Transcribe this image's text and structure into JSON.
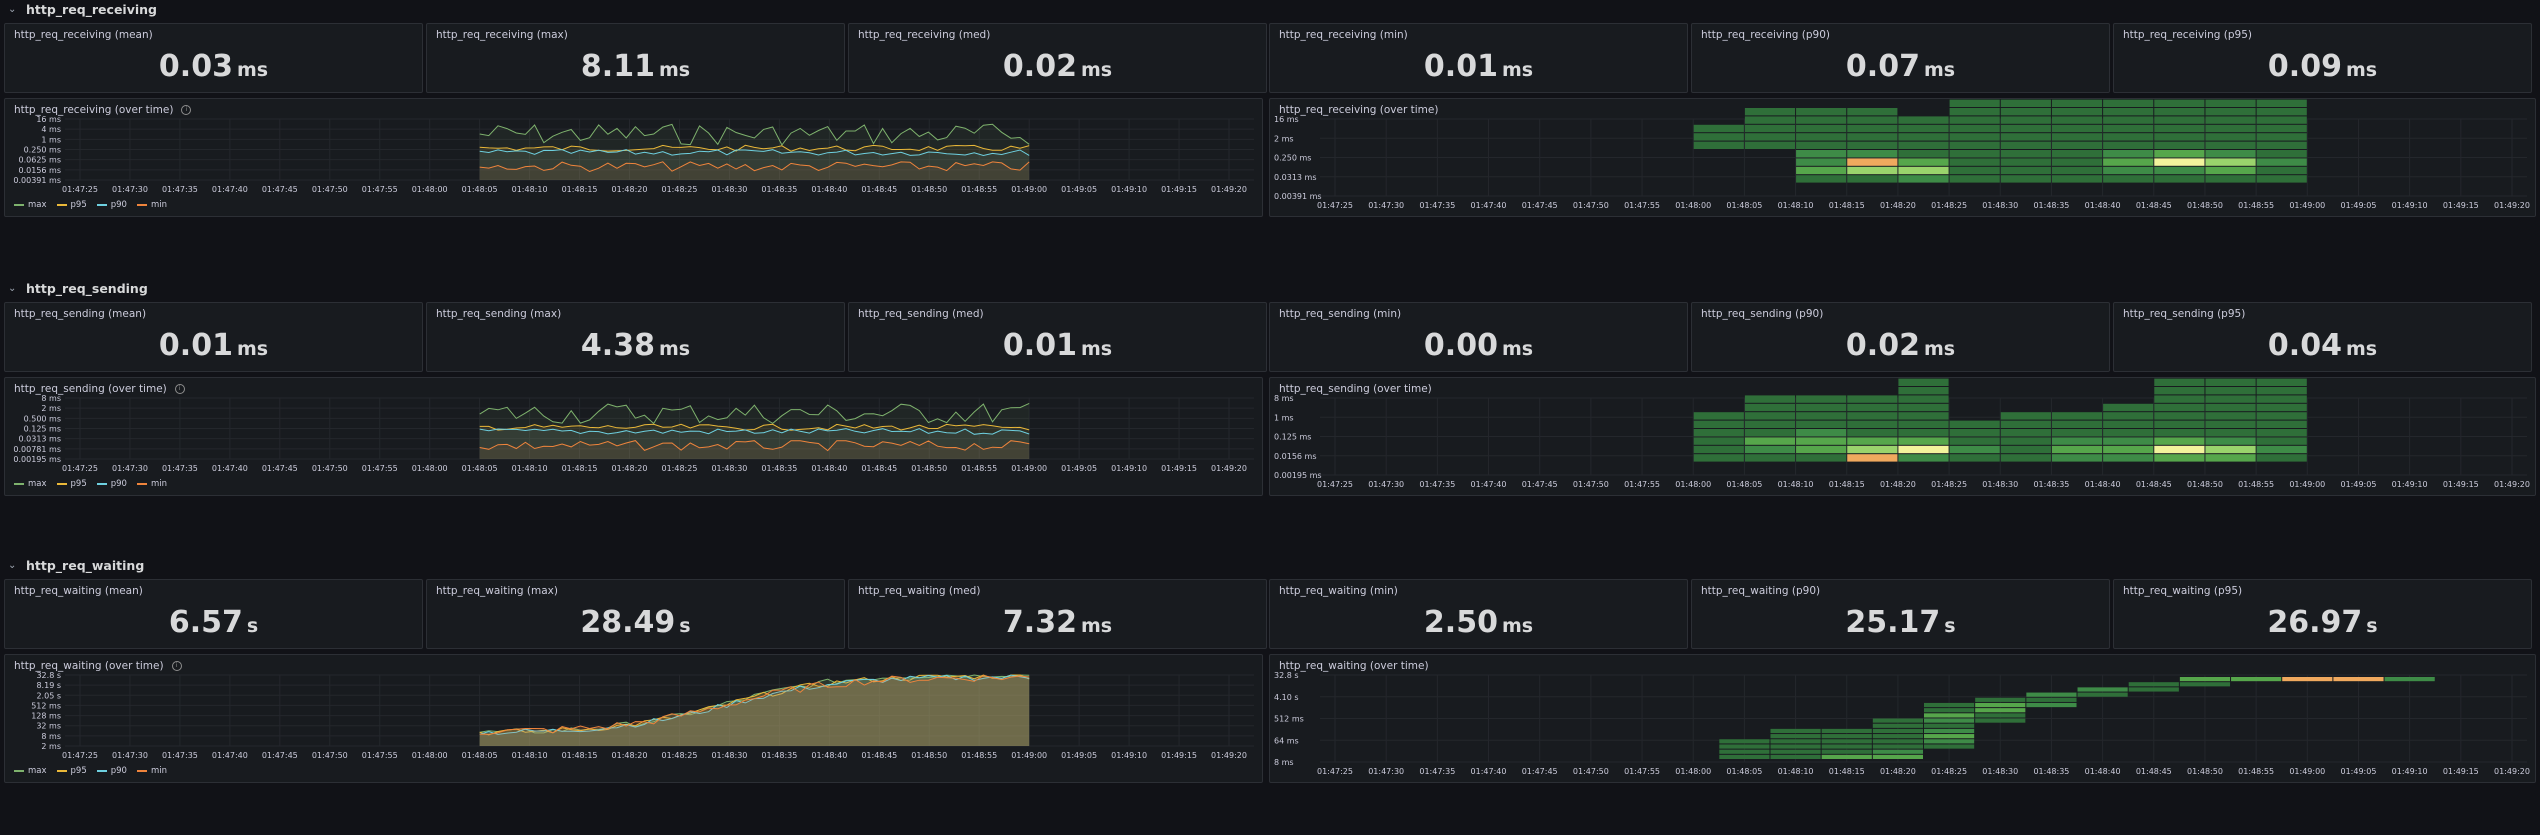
{
  "colors": {
    "max": "#7eb26d",
    "p95": "#eab839",
    "p90": "#6ed0e0",
    "min": "#ef843c",
    "heat_levels": [
      "#2f6f39",
      "#3e8b47",
      "#56a64b",
      "#9ad36c",
      "#f2f39c",
      "#f0a95e",
      "#c4302b"
    ]
  },
  "sections": [
    {
      "header": "http_req_receiving",
      "stats": [
        {
          "title": "http_req_receiving (mean)",
          "value": "0.03",
          "unit": "ms"
        },
        {
          "title": "http_req_receiving (max)",
          "value": "8.11",
          "unit": "ms"
        },
        {
          "title": "http_req_receiving (med)",
          "value": "0.02",
          "unit": "ms"
        },
        {
          "title": "http_req_receiving (min)",
          "value": "0.01",
          "unit": "ms"
        },
        {
          "title": "http_req_receiving (p90)",
          "value": "0.07",
          "unit": "ms"
        },
        {
          "title": "http_req_receiving (p95)",
          "value": "0.09",
          "unit": "ms"
        }
      ],
      "timeseries": {
        "title": "http_req_receiving (over time)",
        "y_ticks": [
          "16 ms",
          "4 ms",
          "1 ms",
          "0.250 ms",
          "0.0625 ms",
          "0.0156 ms",
          "0.00391 ms"
        ],
        "legend": [
          "max",
          "p95",
          "p90",
          "min"
        ]
      },
      "heatmap": {
        "title": "http_req_receiving (over time)",
        "y_ticks": [
          "16 ms",
          "2 ms",
          "0.250 ms",
          "0.0313 ms",
          "0.00391 ms"
        ]
      }
    },
    {
      "header": "http_req_sending",
      "stats": [
        {
          "title": "http_req_sending (mean)",
          "value": "0.01",
          "unit": "ms"
        },
        {
          "title": "http_req_sending (max)",
          "value": "4.38",
          "unit": "ms"
        },
        {
          "title": "http_req_sending (med)",
          "value": "0.01",
          "unit": "ms"
        },
        {
          "title": "http_req_sending (min)",
          "value": "0.00",
          "unit": "ms"
        },
        {
          "title": "http_req_sending (p90)",
          "value": "0.02",
          "unit": "ms"
        },
        {
          "title": "http_req_sending (p95)",
          "value": "0.04",
          "unit": "ms"
        }
      ],
      "timeseries": {
        "title": "http_req_sending (over time)",
        "y_ticks": [
          "8 ms",
          "2 ms",
          "0.500 ms",
          "0.125 ms",
          "0.0313 ms",
          "0.00781 ms",
          "0.00195 ms"
        ],
        "legend": [
          "max",
          "p95",
          "p90",
          "min"
        ]
      },
      "heatmap": {
        "title": "http_req_sending (over time)",
        "y_ticks": [
          "8 ms",
          "1 ms",
          "0.125 ms",
          "0.0156 ms",
          "0.00195 ms"
        ]
      }
    },
    {
      "header": "http_req_waiting",
      "stats": [
        {
          "title": "http_req_waiting (mean)",
          "value": "6.57",
          "unit": "s"
        },
        {
          "title": "http_req_waiting (max)",
          "value": "28.49",
          "unit": "s"
        },
        {
          "title": "http_req_waiting (med)",
          "value": "7.32",
          "unit": "ms"
        },
        {
          "title": "http_req_waiting (min)",
          "value": "2.50",
          "unit": "ms"
        },
        {
          "title": "http_req_waiting (p90)",
          "value": "25.17",
          "unit": "s"
        },
        {
          "title": "http_req_waiting (p95)",
          "value": "26.97",
          "unit": "s"
        }
      ],
      "timeseries": {
        "title": "http_req_waiting (over time)",
        "y_ticks": [
          "32.8 s",
          "8.19 s",
          "2.05 s",
          "512 ms",
          "128 ms",
          "32 ms",
          "8 ms",
          "2 ms"
        ],
        "legend": [
          "max",
          "p95",
          "p90",
          "min"
        ]
      },
      "heatmap": {
        "title": "http_req_waiting (over time)",
        "y_ticks": [
          "32.8 s",
          "4.10 s",
          "512 ms",
          "64 ms",
          "8 ms"
        ]
      }
    }
  ],
  "x_ticks": [
    "01:47:25",
    "01:47:30",
    "01:47:35",
    "01:47:40",
    "01:47:45",
    "01:47:50",
    "01:47:55",
    "01:48:00",
    "01:48:05",
    "01:48:10",
    "01:48:15",
    "01:48:20",
    "01:48:25",
    "01:48:30",
    "01:48:35",
    "01:48:40",
    "01:48:45",
    "01:48:50",
    "01:48:55",
    "01:49:00",
    "01:49:05",
    "01:49:10",
    "01:49:15",
    "01:49:20"
  ],
  "heat_cells": [
    [
      [
        0,
        1,
        [
          0,
          0,
          0,
          0,
          0,
          1,
          1,
          1,
          0
        ]
      ],
      [
        1,
        1,
        [
          0,
          0,
          0,
          0,
          0,
          1,
          1,
          1,
          1,
          1,
          0
        ]
      ],
      [
        2,
        1,
        [
          0,
          1,
          3,
          2,
          2,
          1,
          1,
          1,
          1,
          1
        ]
      ],
      [
        3,
        1,
        [
          0,
          1,
          4,
          6,
          2,
          1,
          1,
          1,
          1,
          1
        ]
      ],
      [
        4,
        1,
        [
          0,
          2,
          4,
          3,
          1,
          1,
          1,
          1,
          1,
          0
        ]
      ],
      [
        5,
        1,
        [
          0,
          1,
          1,
          1,
          1,
          1,
          1,
          1,
          1,
          1,
          1,
          1,
          0
        ]
      ],
      [
        6,
        1,
        [
          0,
          1,
          1,
          1,
          1,
          1,
          1,
          1,
          1,
          1,
          1
        ]
      ],
      [
        7,
        1,
        [
          0,
          1,
          1,
          1,
          1,
          1,
          1,
          1,
          1,
          1,
          1,
          1,
          0
        ]
      ],
      [
        8,
        1,
        [
          0,
          1,
          2,
          3,
          2,
          1,
          1,
          1,
          1,
          1,
          1
        ]
      ],
      [
        9,
        1,
        [
          0,
          1,
          2,
          5,
          3,
          1,
          1,
          1,
          1,
          1,
          1,
          1
        ]
      ],
      [
        10,
        1,
        [
          0,
          1,
          3,
          4,
          2,
          1,
          1,
          1,
          1,
          1,
          1
        ]
      ],
      [
        11,
        1,
        [
          0,
          1,
          1,
          2,
          1,
          1,
          1,
          1,
          1,
          1,
          1,
          1
        ]
      ]
    ],
    [
      [
        0,
        1,
        [
          0,
          1,
          1,
          1,
          1,
          1,
          1,
          0
        ]
      ],
      [
        1,
        1,
        [
          0,
          1,
          2,
          3,
          1,
          1,
          1,
          1,
          1,
          0
        ]
      ],
      [
        2,
        1,
        [
          0,
          1,
          3,
          3,
          2,
          1,
          1,
          1,
          1
        ]
      ],
      [
        3,
        1,
        [
          0,
          6,
          4,
          3,
          1,
          1,
          1,
          1,
          1
        ]
      ],
      [
        4,
        1,
        [
          0,
          2,
          5,
          3,
          1,
          1,
          1,
          1,
          1,
          1,
          1,
          0
        ]
      ],
      [
        5,
        1,
        [
          0,
          1,
          2,
          1,
          1,
          1
        ]
      ],
      [
        6,
        1,
        [
          0,
          1,
          1,
          1,
          1,
          1,
          1
        ]
      ],
      [
        7,
        1,
        [
          0,
          2,
          3,
          2,
          1,
          1,
          1
        ]
      ],
      [
        8,
        1,
        [
          0,
          2,
          3,
          2,
          1,
          1,
          1,
          1
        ]
      ],
      [
        9,
        1,
        [
          0,
          3,
          5,
          3,
          1,
          1,
          1,
          1,
          1,
          1,
          1
        ]
      ],
      [
        10,
        1,
        [
          0,
          3,
          4,
          2,
          1,
          1,
          1,
          1,
          1,
          1,
          1,
          1,
          0
        ]
      ],
      [
        11,
        1,
        [
          0,
          1,
          2,
          1,
          1,
          1,
          1,
          1,
          1,
          1,
          1
        ]
      ]
    ]
  ],
  "waiting_heat": [
    [
      0,
      0,
      [
        1,
        1,
        1,
        1
      ]
    ],
    [
      1,
      0,
      [
        1,
        1,
        1,
        1,
        1,
        1
      ]
    ],
    [
      2,
      0,
      [
        3,
        1,
        1,
        1,
        1,
        1
      ]
    ],
    [
      3,
      0,
      [
        3,
        2,
        1,
        1,
        1,
        1,
        1,
        1
      ]
    ],
    [
      4,
      2,
      [
        1,
        2,
        3,
        2,
        1,
        2,
        3,
        1,
        1
      ]
    ],
    [
      5,
      7,
      [
        1,
        1,
        3,
        3,
        1
      ]
    ],
    [
      6,
      10,
      [
        2,
        1,
        2
      ]
    ],
    [
      7,
      12,
      [
        1,
        2
      ]
    ],
    [
      8,
      13,
      [
        1,
        1
      ]
    ],
    [
      9,
      14,
      [
        1,
        3
      ]
    ],
    [
      10,
      15,
      [
        3
      ]
    ],
    [
      11,
      15,
      [
        6
      ]
    ],
    [
      12,
      15,
      [
        6
      ]
    ],
    [
      13,
      15,
      [
        2
      ]
    ]
  ]
}
